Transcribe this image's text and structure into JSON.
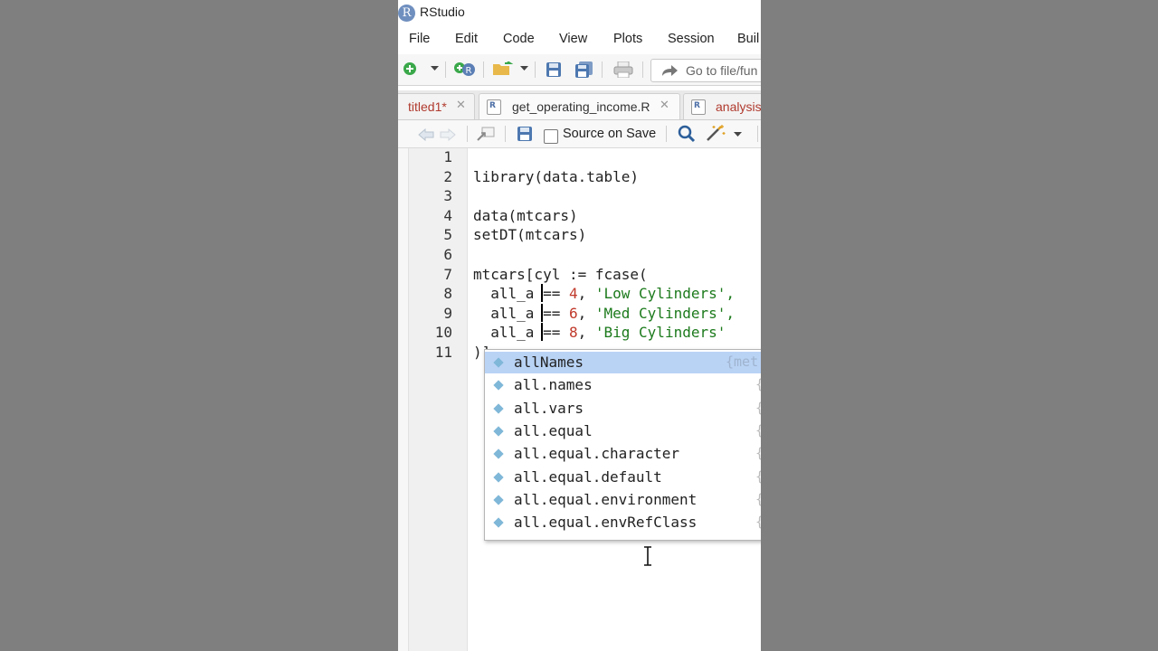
{
  "window": {
    "title": "RStudio",
    "logo": "R"
  },
  "menu": [
    "File",
    "Edit",
    "Code",
    "View",
    "Plots",
    "Session",
    "Buil"
  ],
  "toolbar": {
    "goto_placeholder": "Go to file/fun"
  },
  "tabs": [
    {
      "label": "titled1*",
      "close": "✕"
    },
    {
      "label": "get_operating_income.R",
      "close": "✕"
    },
    {
      "label": "analysis"
    }
  ],
  "editor_toolbar": {
    "source_on_save": "Source on Save"
  },
  "editor": {
    "line_numbers": [
      "1",
      "2",
      "3",
      "4",
      "5",
      "6",
      "7",
      "8",
      "9",
      "10",
      "11"
    ],
    "lines": [
      "",
      "library(data.table)",
      "",
      "data(mtcars)",
      "setDT(mtcars)",
      "",
      "mtcars[cyl := fcase(",
      {
        "pre": "  all_a == ",
        "num": "4",
        "mid": ", ",
        "str": "'Low Cylinders',"
      },
      {
        "pre": "  all_a == ",
        "num": "6",
        "mid": ", ",
        "str": "'Med Cylinders',"
      },
      {
        "pre": "  all_a == ",
        "num": "8",
        "mid": ", ",
        "str": "'Big Cylinders'"
      },
      ")]"
    ]
  },
  "autocomplete": {
    "items": [
      {
        "label": "allNames",
        "source": "{met"
      },
      {
        "label": "all.names",
        "source": "{"
      },
      {
        "label": "all.vars",
        "source": "{"
      },
      {
        "label": "all.equal",
        "source": "{"
      },
      {
        "label": "all.equal.character",
        "source": "{"
      },
      {
        "label": "all.equal.default",
        "source": "{"
      },
      {
        "label": "all.equal.environment",
        "source": "{"
      },
      {
        "label": "all.equal.envRefClass",
        "source": "{"
      }
    ],
    "selected_index": 0
  },
  "colors": {
    "number": "#c0392b",
    "string": "#1c7a1c",
    "selection": "#b9d3f5",
    "tab_modified": "#b03a2e"
  }
}
